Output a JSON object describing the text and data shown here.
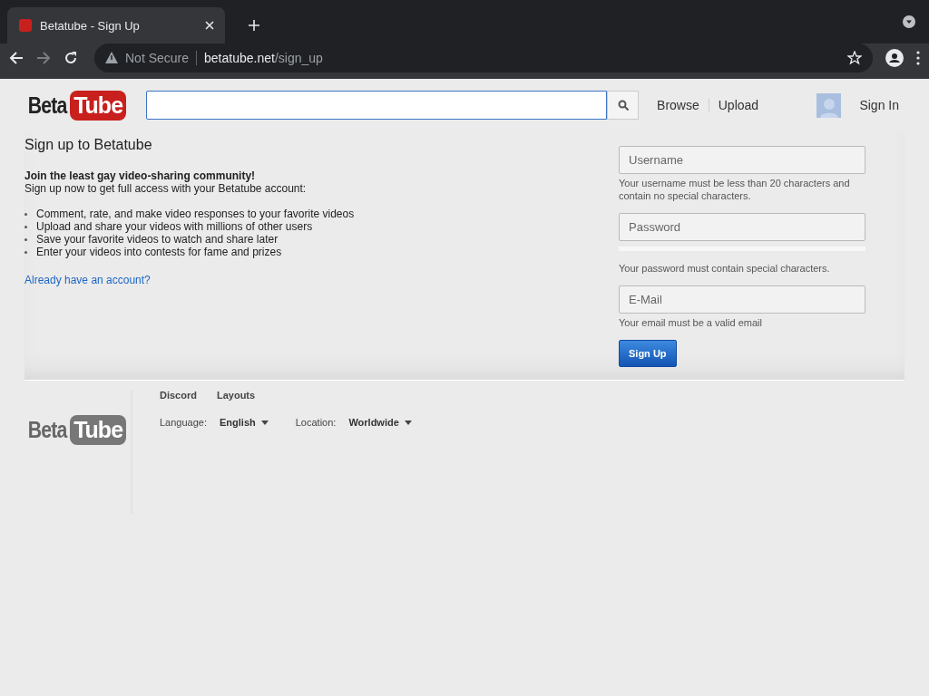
{
  "browser": {
    "tab_title": "Betatube - Sign Up",
    "security": "Not Secure",
    "url_host": "betatube.net",
    "url_path": "/sign_up"
  },
  "header": {
    "logo": {
      "left": "Beta",
      "right": "Tube"
    },
    "nav": [
      "Browse",
      "Upload"
    ],
    "sign_in": "Sign In"
  },
  "main": {
    "title": "Sign up to Betatube",
    "tagline": "Join the least gay video-sharing community!",
    "intro": "Sign up now to get full access with your Betatube account:",
    "features": [
      "Comment, rate, and make video responses to your favorite videos",
      "Upload and share your videos with millions of other users",
      "Save your favorite videos to watch and share later",
      "Enter your videos into contests for fame and prizes"
    ],
    "login_link": "Already have an account?"
  },
  "form": {
    "fields": [
      {
        "placeholder": "Username",
        "hint": "Your username must be less than 20 characters and contain no special characters."
      },
      {
        "placeholder": "Password",
        "level": 0,
        "hint": "Your password must contain special characters."
      },
      {
        "placeholder": "E-Mail",
        "hint": "Your email must be a valid email"
      }
    ],
    "submit": "Sign Up"
  },
  "footer": {
    "logo": {
      "left": "Beta",
      "right": "Tube"
    },
    "links": [
      "Discord",
      "Layouts"
    ],
    "language_label": "Language:",
    "language": "English",
    "location_label": "Location:",
    "location": "Worldwide"
  }
}
